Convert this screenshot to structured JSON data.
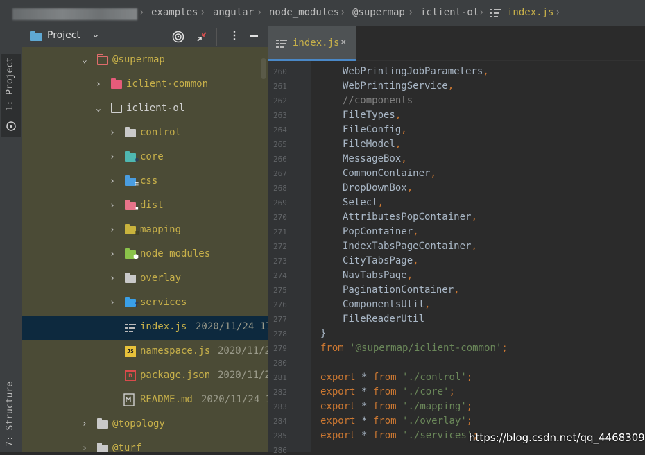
{
  "breadcrumb": [
    {
      "label": "examples"
    },
    {
      "label": "angular"
    },
    {
      "label": "node_modules"
    },
    {
      "label": "@supermap"
    },
    {
      "label": "iclient-ol"
    },
    {
      "label": "index.js"
    }
  ],
  "sidebar": {
    "project_tab": "1: Project",
    "structure_tab": "7: Structure"
  },
  "panel": {
    "title": "Project",
    "tree": [
      {
        "label": "@supermap",
        "date": ""
      },
      {
        "label": "iclient-common",
        "date": ""
      },
      {
        "label": "iclient-ol",
        "date": ""
      },
      {
        "label": "control",
        "date": ""
      },
      {
        "label": "core",
        "date": ""
      },
      {
        "label": "css",
        "date": ""
      },
      {
        "label": "dist",
        "date": ""
      },
      {
        "label": "mapping",
        "date": ""
      },
      {
        "label": "node_modules",
        "date": ""
      },
      {
        "label": "overlay",
        "date": ""
      },
      {
        "label": "services",
        "date": ""
      },
      {
        "label": "index.js",
        "date": "2020/11/24 17"
      },
      {
        "label": "namespace.js",
        "date": "2020/11/2"
      },
      {
        "label": "package.json",
        "date": "2020/11/2"
      },
      {
        "label": "README.md",
        "date": "2020/11/24 1"
      },
      {
        "label": "@topology",
        "date": ""
      },
      {
        "label": "@turf",
        "date": ""
      }
    ]
  },
  "editor": {
    "tab_label": "index.js",
    "line_numbers": [
      "260",
      "261",
      "262",
      "263",
      "264",
      "265",
      "266",
      "267",
      "268",
      "269",
      "270",
      "271",
      "272",
      "273",
      "274",
      "275",
      "276",
      "277",
      "278",
      "279",
      "280",
      "281",
      "282",
      "283",
      "284",
      "285",
      "286"
    ],
    "lines": [
      {
        "a": "WebPrintingJobParameters",
        "b": ","
      },
      {
        "a": "WebPrintingService",
        "b": ","
      },
      {
        "a": "//components",
        "b": ""
      },
      {
        "a": "FileTypes",
        "b": ","
      },
      {
        "a": "FileConfig",
        "b": ","
      },
      {
        "a": "FileModel",
        "b": ","
      },
      {
        "a": "MessageBox",
        "b": ","
      },
      {
        "a": "CommonContainer",
        "b": ","
      },
      {
        "a": "DropDownBox",
        "b": ","
      },
      {
        "a": "Select",
        "b": ","
      },
      {
        "a": "AttributesPopContainer",
        "b": ","
      },
      {
        "a": "PopContainer",
        "b": ","
      },
      {
        "a": "IndexTabsPageContainer",
        "b": ","
      },
      {
        "a": "CityTabsPage",
        "b": ","
      },
      {
        "a": "NavTabsPage",
        "b": ","
      },
      {
        "a": "PaginationContainer",
        "b": ","
      },
      {
        "a": "ComponentsUtil",
        "b": ","
      },
      {
        "a": "FileReaderUtil",
        "b": ""
      },
      {
        "a": "}",
        "b": ""
      },
      {
        "kw": "from",
        "str": "'@supermap/iclient-common'",
        "end": ";"
      },
      {
        "a": "",
        "b": ""
      },
      {
        "kw": "export",
        "op": " * ",
        "kw2": "from",
        "str": "'./control'",
        "end": ";"
      },
      {
        "kw": "export",
        "op": " * ",
        "kw2": "from",
        "str": "'./core'",
        "end": ";"
      },
      {
        "kw": "export",
        "op": " * ",
        "kw2": "from",
        "str": "'./mapping'",
        "end": ";"
      },
      {
        "kw": "export",
        "op": " * ",
        "kw2": "from",
        "str": "'./overlay'",
        "end": ";"
      },
      {
        "kw": "export",
        "op": " * ",
        "kw2": "from",
        "str": "'./services'",
        "end": ";"
      }
    ]
  },
  "watermark": "https://blog.csdn.net/qq_44683095"
}
